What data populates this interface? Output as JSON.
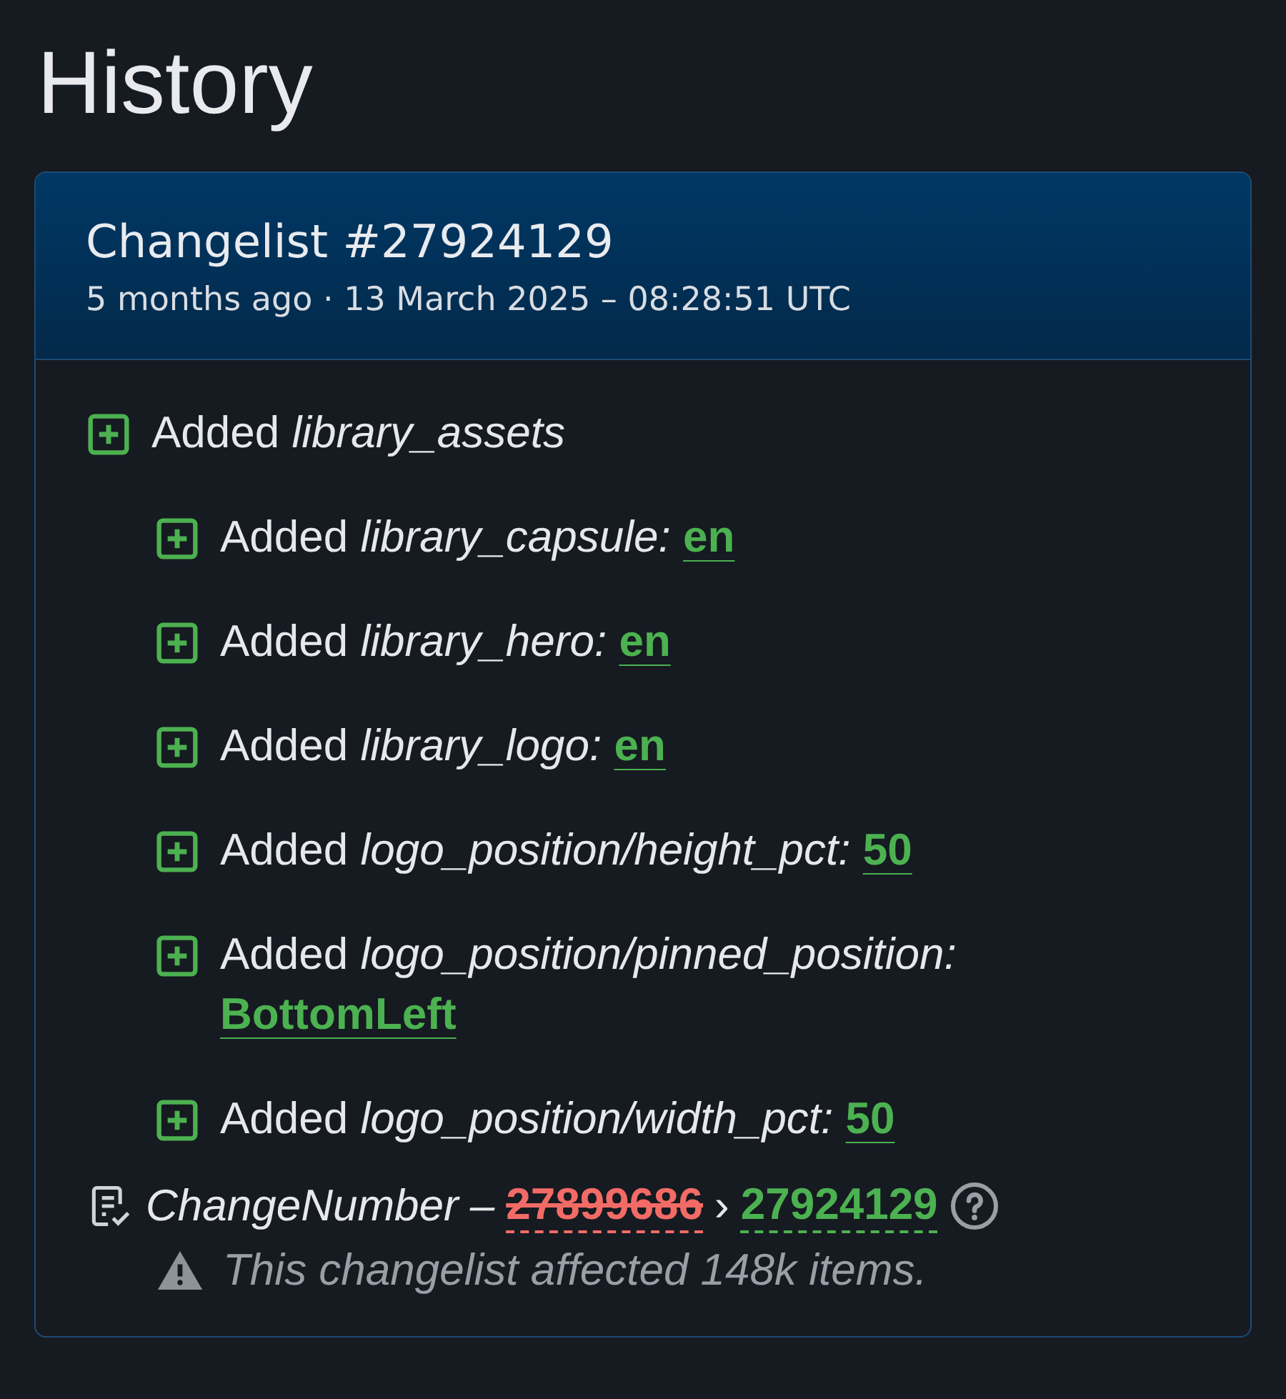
{
  "page_title": "History",
  "changelist": {
    "title": "Changelist #27924129",
    "subtitle": "5 months ago · 13 March 2025 – 08:28:51 UTC",
    "changes": [
      {
        "action": "Added",
        "key": "library_assets",
        "children": [
          {
            "action": "Added",
            "key": "library_capsule:",
            "value": "en"
          },
          {
            "action": "Added",
            "key": "library_hero:",
            "value": "en"
          },
          {
            "action": "Added",
            "key": "library_logo:",
            "value": "en"
          },
          {
            "action": "Added",
            "key": "logo_position/height_pct:",
            "value": "50"
          },
          {
            "action": "Added",
            "key": "logo_position/pinned_position:",
            "value": "BottomLeft"
          },
          {
            "action": "Added",
            "key": "logo_position/width_pct:",
            "value": "50"
          }
        ]
      }
    ],
    "change_number": {
      "label": "ChangeNumber",
      "separator": "–",
      "old": "27899686",
      "arrow": "›",
      "new": "27924129"
    },
    "warning": "This changelist affected 148k items."
  }
}
